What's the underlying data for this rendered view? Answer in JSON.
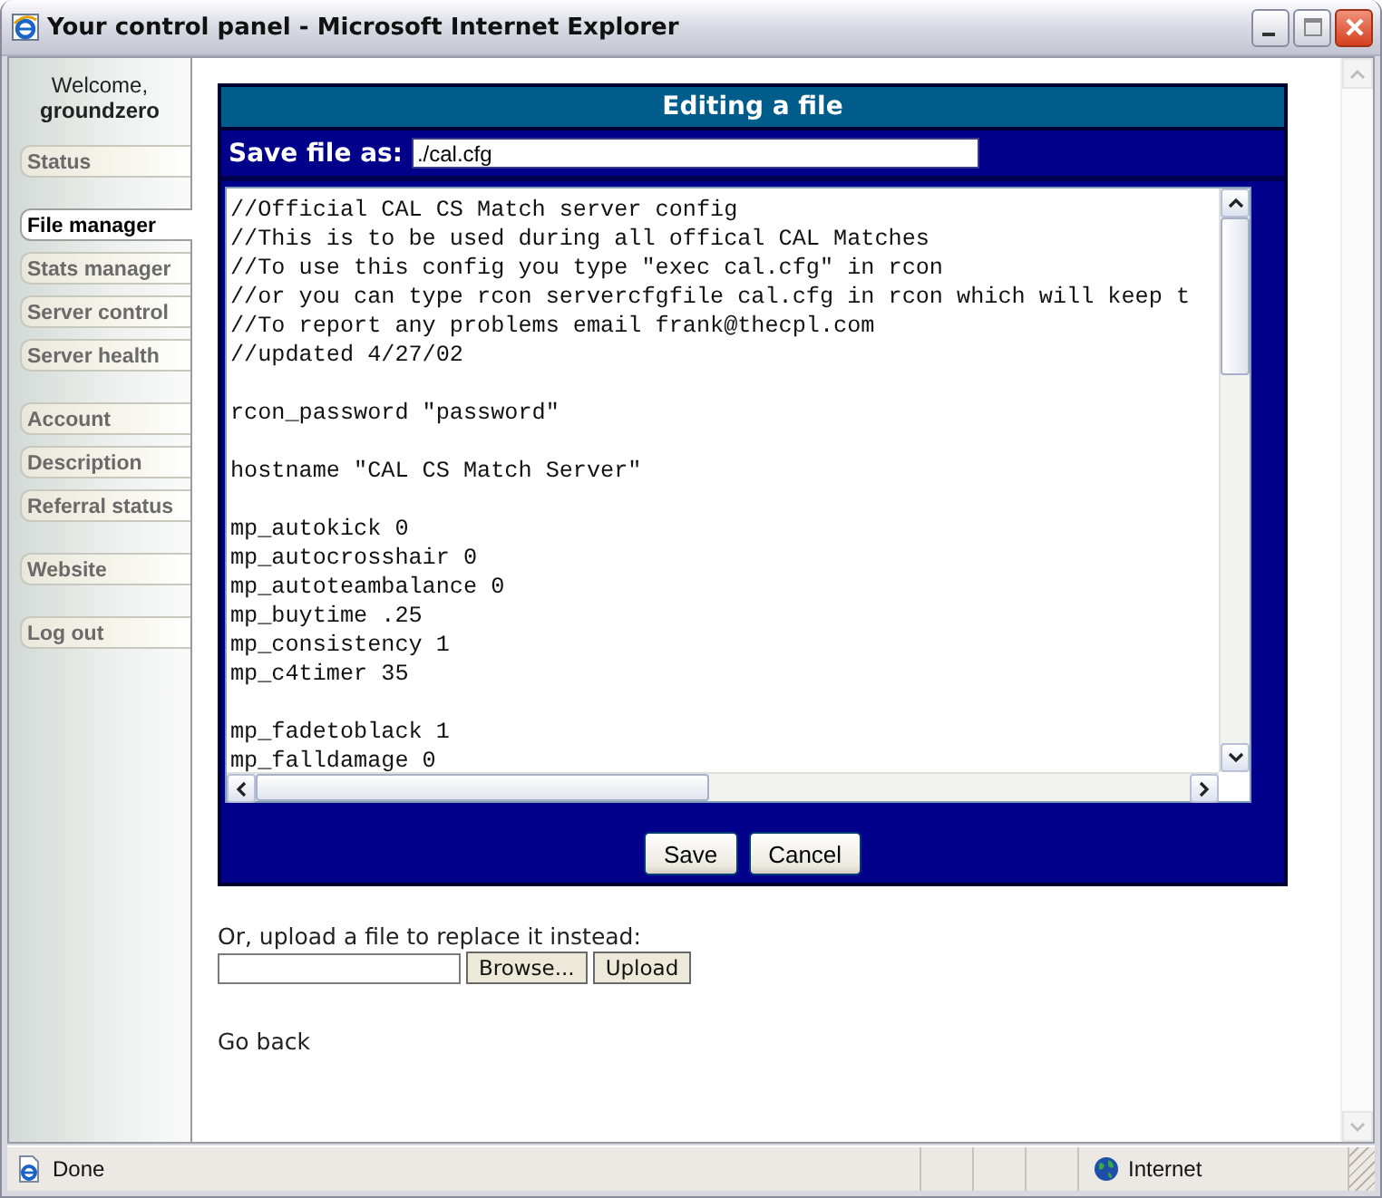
{
  "window": {
    "title": "Your control panel - Microsoft Internet Explorer"
  },
  "sidebar": {
    "welcome": "Welcome,",
    "user": "groundzero",
    "groups": [
      [
        {
          "label": "Status",
          "selected": false
        }
      ],
      [
        {
          "label": "File manager",
          "selected": true
        },
        {
          "label": "Stats manager",
          "selected": false
        },
        {
          "label": "Server control",
          "selected": false
        },
        {
          "label": "Server health",
          "selected": false
        }
      ],
      [
        {
          "label": "Account",
          "selected": false
        },
        {
          "label": "Description",
          "selected": false
        },
        {
          "label": "Referral status",
          "selected": false
        }
      ],
      [
        {
          "label": "Website",
          "selected": false
        }
      ],
      [
        {
          "label": "Log out",
          "selected": false
        }
      ]
    ]
  },
  "editor": {
    "title": "Editing a file",
    "save_label": "Save file as:",
    "filename": "./cal.cfg",
    "blocks": [
      [
        "//Official CAL CS Match server config",
        "//This is to be used during all offical CAL Matches",
        "//To use this config you type \"exec cal.cfg\" in rcon",
        "//or you can type rcon servercfgfile cal.cfg in rcon which will keep t",
        "//To report any problems email frank@thecpl.com",
        "//updated 4/27/02"
      ],
      [
        "rcon_password \"password\""
      ],
      [
        "hostname \"CAL CS Match Server\""
      ],
      [
        "mp_autokick 0",
        "mp_autocrosshair 0",
        "mp_autoteambalance 0",
        "mp_buytime .25",
        "mp_consistency 1",
        "mp_c4timer 35"
      ],
      [
        "mp_fadetoblack 1",
        "mp_falldamage 0"
      ]
    ],
    "buttons": [
      "Save",
      "Cancel"
    ]
  },
  "upload": {
    "prompt": "Or, upload a file to replace it instead:",
    "browse": "Browse...",
    "submit": "Upload"
  },
  "go_back": "Go back",
  "status_bar": {
    "text": "Done",
    "zone": "Internet"
  }
}
